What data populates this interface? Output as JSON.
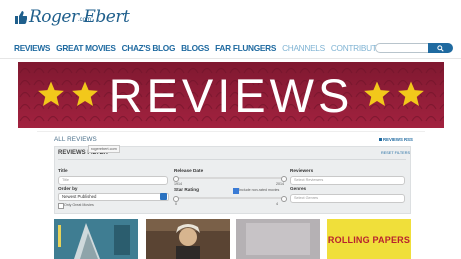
{
  "logo": {
    "wordmark": "Roger Ebert",
    "suffix": ".com"
  },
  "nav": {
    "items": [
      {
        "label": "REVIEWS",
        "muted": false
      },
      {
        "label": "GREAT MOVIES",
        "muted": false
      },
      {
        "label": "CHAZ'S BLOG",
        "muted": false
      },
      {
        "label": "BLOGS",
        "muted": false
      },
      {
        "label": "FAR FLUNGERS",
        "muted": false
      },
      {
        "label": "CHANNELS",
        "muted": true
      },
      {
        "label": "CONTRIBUTORS",
        "muted": true
      }
    ]
  },
  "search": {
    "placeholder": ""
  },
  "banner": {
    "title": "REVIEWS"
  },
  "section": {
    "heading": "ALL REVIEWS",
    "rss": "REVIEWS RSS"
  },
  "filters": {
    "title": "REVIEWS FILTER",
    "tooltip": "rogerebert.com",
    "reset": "RESET FILTERS",
    "title_label": "Title",
    "title_placeholder": "Title",
    "order_label": "Order by",
    "order_value": "Newest Published",
    "great_movies_label": "Only Great Movies",
    "release_date_label": "Release Date",
    "release_min": "1914",
    "release_max": "2014",
    "star_rating_label": "Star Rating",
    "include_unrated_label": "Include non-rated movies",
    "include_unrated_checked": true,
    "star_min": "0",
    "star_max": "4",
    "reviewers_label": "Reviewers",
    "reviewers_placeholder": "Select Reviewers",
    "genres_label": "Genres",
    "genres_placeholder": "Select Genres"
  },
  "tiles": {
    "tile4_text": "ROLLING PAPERS"
  },
  "colors": {
    "brand_blue": "#1f6aa0",
    "banner_red": "#8e1b36",
    "star_gold": "#f2c81b"
  }
}
